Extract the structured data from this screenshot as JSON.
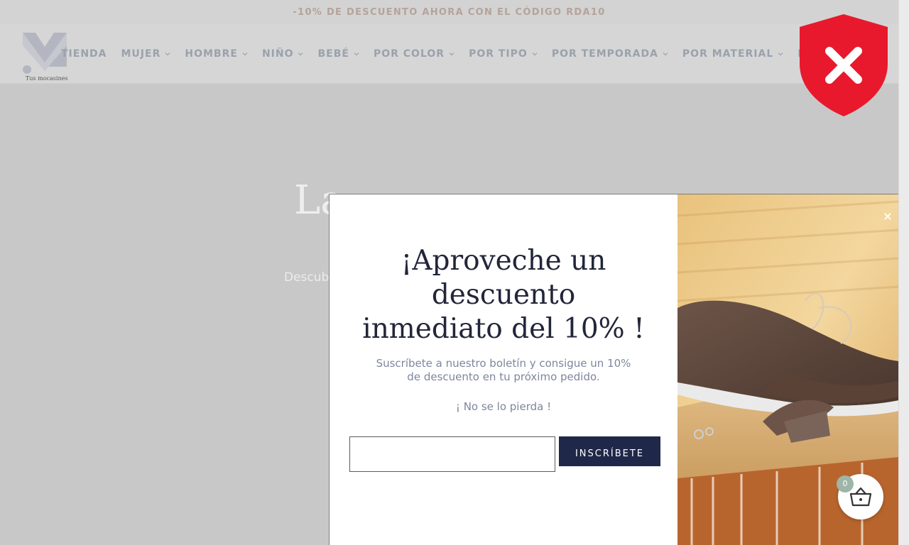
{
  "announcement": "-10% DE DESCUENTO AHORA CON EL CÓDIGO RDA10",
  "logo": {
    "tagline": "Tus mocasines"
  },
  "nav": {
    "items": [
      {
        "label": "TIENDA",
        "has_dropdown": false
      },
      {
        "label": "MUJER",
        "has_dropdown": true
      },
      {
        "label": "HOMBRE",
        "has_dropdown": true
      },
      {
        "label": "NIÑO",
        "has_dropdown": true
      },
      {
        "label": "BEBÉ",
        "has_dropdown": true
      },
      {
        "label": "POR COLOR",
        "has_dropdown": true
      },
      {
        "label": "POR TIPO",
        "has_dropdown": true
      },
      {
        "label": "POR TEMPORADA",
        "has_dropdown": true
      },
      {
        "label": "POR MATERIAL",
        "has_dropdown": true
      },
      {
        "label": "LISTA DE DE",
        "has_dropdown": false
      }
    ]
  },
  "hero": {
    "title": "La",
    "subtitle": "Descub"
  },
  "popup": {
    "title_lines": [
      "¡Aproveche un",
      "descuento",
      "inmediato del 10% !"
    ],
    "text": "Suscríbete a nuestro boletín y consigue un 10% de descuento en tu próximo pedido.",
    "note": "¡ No se lo pierda !",
    "email_value": "",
    "subscribe_label": "INSCRÍBETE",
    "close_label": "×"
  },
  "cart": {
    "count": "0"
  },
  "colors": {
    "brand_navy": "#202849",
    "accent_tan": "#b5a39a",
    "shield_red": "#e8192c",
    "cart_badge": "#9fb5a8"
  },
  "icons": {
    "shield": "shield-x-icon",
    "cart": "basket-icon",
    "close": "close-icon",
    "chevron": "chevron-down-icon"
  }
}
